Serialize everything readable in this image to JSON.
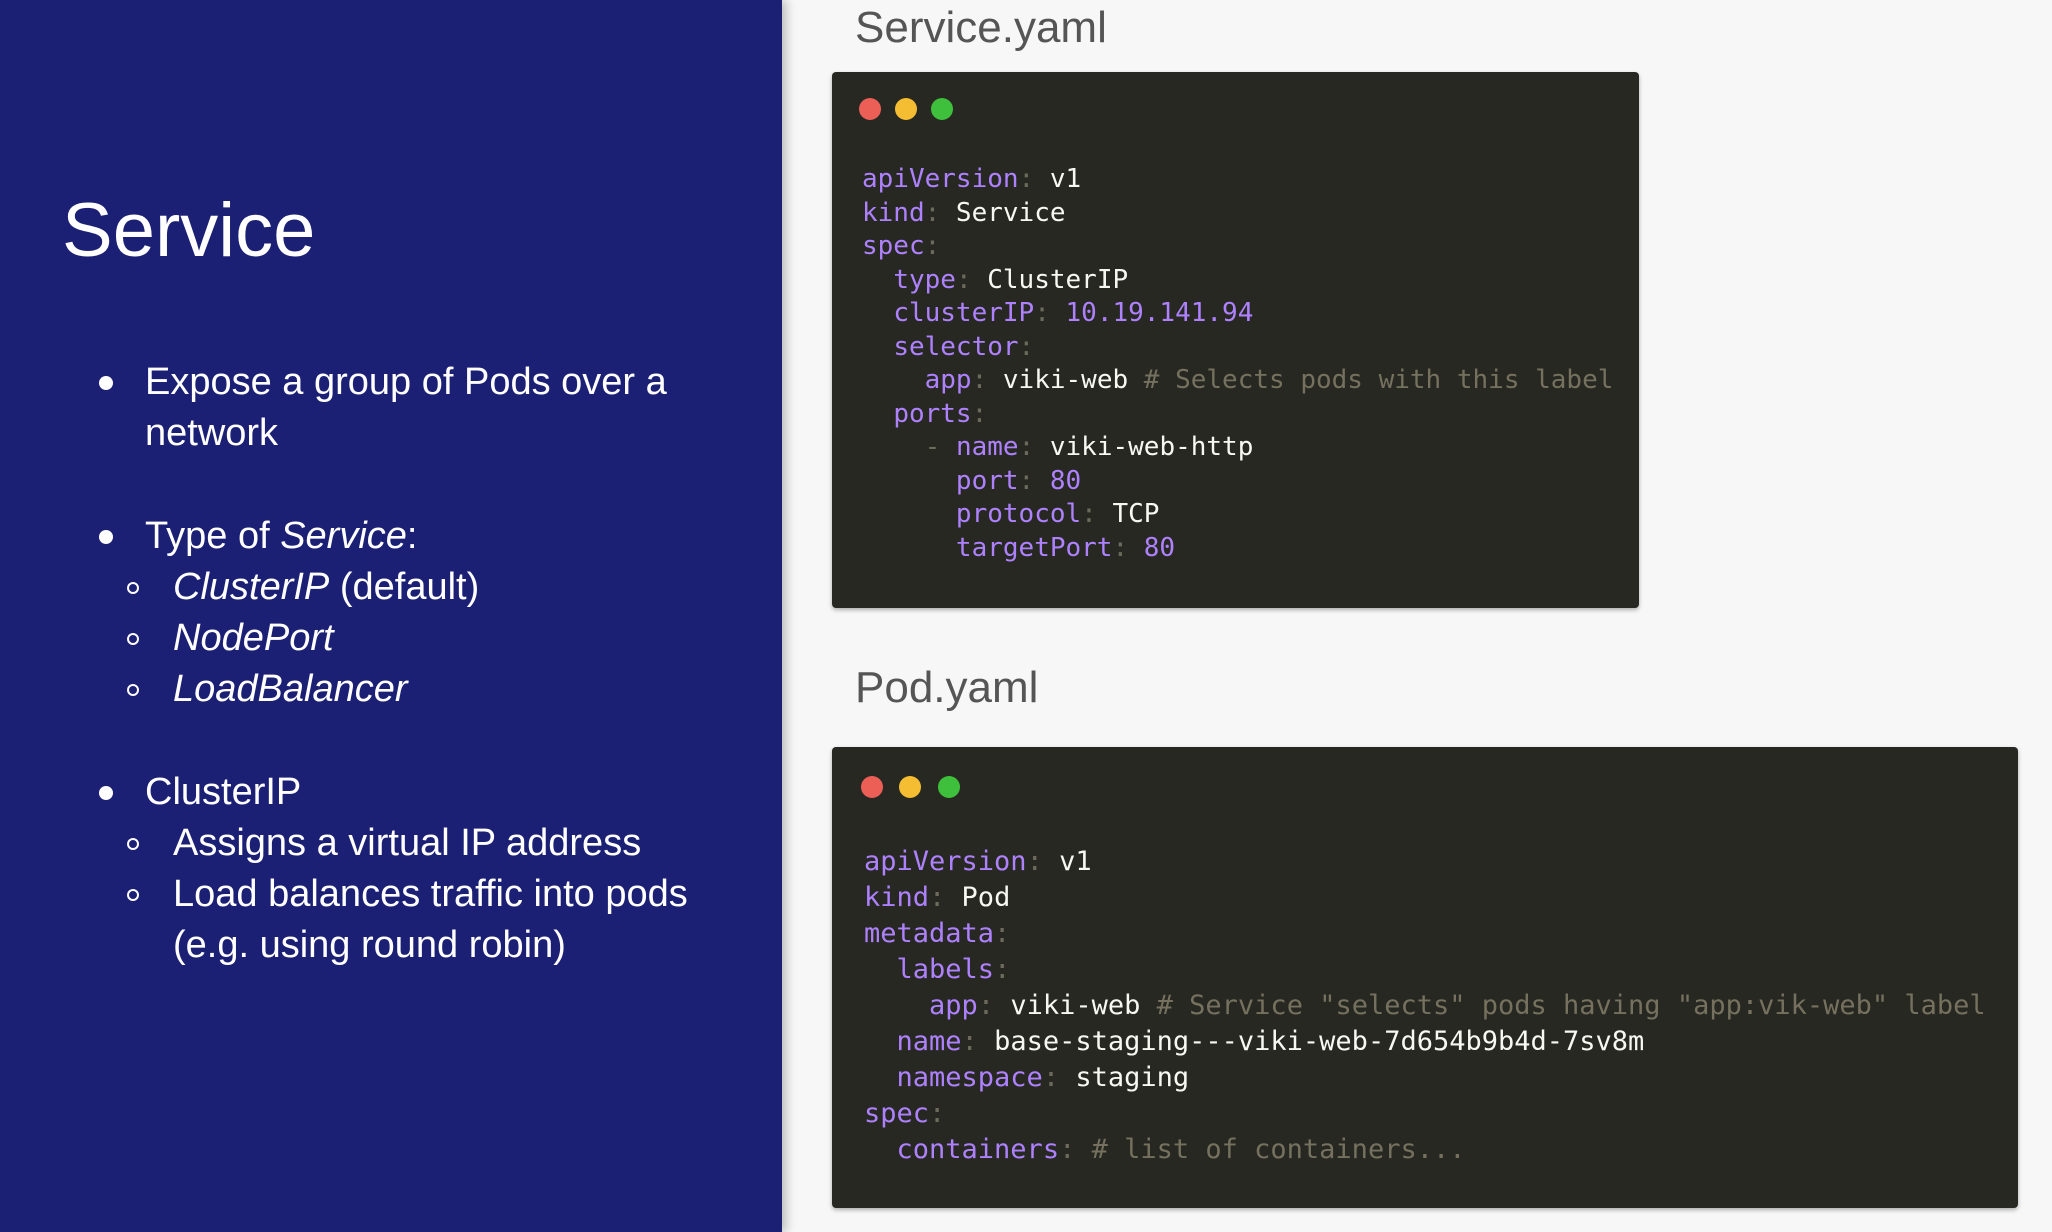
{
  "slide": {
    "title": "Service",
    "bullets": [
      {
        "l1": "Expose a group of Pods over a",
        "l2": "network"
      },
      {
        "prefix": "Type of ",
        "italic": "Service",
        "suffix": ":"
      },
      {
        "sub": [
          {
            "italic": "ClusterIP",
            "suffix": " (default)"
          },
          {
            "italic": "NodePort"
          },
          {
            "italic": "LoadBalancer"
          }
        ]
      },
      {
        "text": "ClusterIP"
      },
      {
        "sub2": [
          {
            "text": "Assigns a virtual IP address"
          },
          {
            "text": "Load balances traffic into pods",
            "text2": "(e.g. using round robin)"
          }
        ]
      }
    ]
  },
  "files": {
    "service": {
      "label": "Service.yaml",
      "lines": [
        {
          "key": "apiVersion",
          "val": "v1"
        },
        {
          "key": "kind",
          "val": "Service"
        },
        {
          "key": "spec",
          "val": ""
        },
        {
          "indent": "  ",
          "key": "type",
          "val": "ClusterIP"
        },
        {
          "indent": "  ",
          "key": "clusterIP",
          "num": "10.19.141.94"
        },
        {
          "indent": "  ",
          "key": "selector",
          "val": ""
        },
        {
          "indent": "    ",
          "key": "app",
          "val": "viki-web",
          "comment": "# Selects pods with this label"
        },
        {
          "indent": "  ",
          "key": "ports",
          "val": ""
        },
        {
          "indent": "    ",
          "dash": "- ",
          "key": "name",
          "val": "viki-web-http"
        },
        {
          "indent": "      ",
          "key": "port",
          "num": "80"
        },
        {
          "indent": "      ",
          "key": "protocol",
          "val": "TCP"
        },
        {
          "indent": "      ",
          "key": "targetPort",
          "num": "80"
        }
      ]
    },
    "pod": {
      "label": "Pod.yaml",
      "lines": [
        {
          "key": "apiVersion",
          "val": "v1"
        },
        {
          "key": "kind",
          "val": "Pod"
        },
        {
          "key": "metadata",
          "val": ""
        },
        {
          "indent": "  ",
          "key": "labels",
          "val": ""
        },
        {
          "indent": "    ",
          "key": "app",
          "val": "viki-web",
          "comment": "# Service \"selects\" pods having \"app:vik-web\" label"
        },
        {
          "indent": "  ",
          "key": "name",
          "val": "base-staging---viki-web-7d654b9b4d-7sv8m"
        },
        {
          "indent": "  ",
          "key": "namespace",
          "val": "staging"
        },
        {
          "key": "spec",
          "val": ""
        },
        {
          "indent": "  ",
          "key": "containers",
          "comment": "# list of containers..."
        }
      ]
    }
  },
  "colors": {
    "panel": "#1c2075",
    "code_bg": "#272822",
    "traffic_red": "#ec5f57",
    "traffic_yellow": "#f5bd31",
    "traffic_green": "#3fc03c",
    "key": "#ae81ff",
    "comment": "#75715e"
  }
}
